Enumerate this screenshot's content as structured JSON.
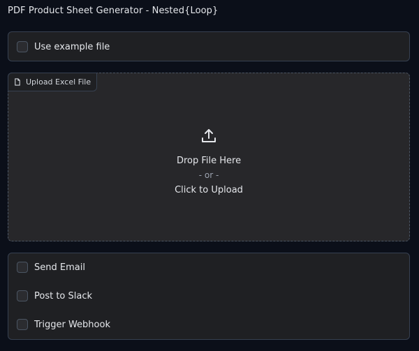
{
  "app": {
    "title": "PDF Product Sheet Generator - Nested{Loop}"
  },
  "example_option": {
    "label": "Use example file"
  },
  "upload": {
    "tab_label": "Upload Excel File",
    "drop_text": "Drop File Here",
    "or_text": "- or -",
    "click_text": "Click to Upload"
  },
  "actions": {
    "send_email": "Send Email",
    "post_slack": "Post to Slack",
    "trigger_webhook": "Trigger Webhook"
  },
  "icons": {
    "tab": "file-icon",
    "drop": "upload-icon"
  },
  "colors": {
    "background": "#0b0f19",
    "panel": "#1f2023",
    "upload_area": "#27272a",
    "border": "#374151"
  }
}
